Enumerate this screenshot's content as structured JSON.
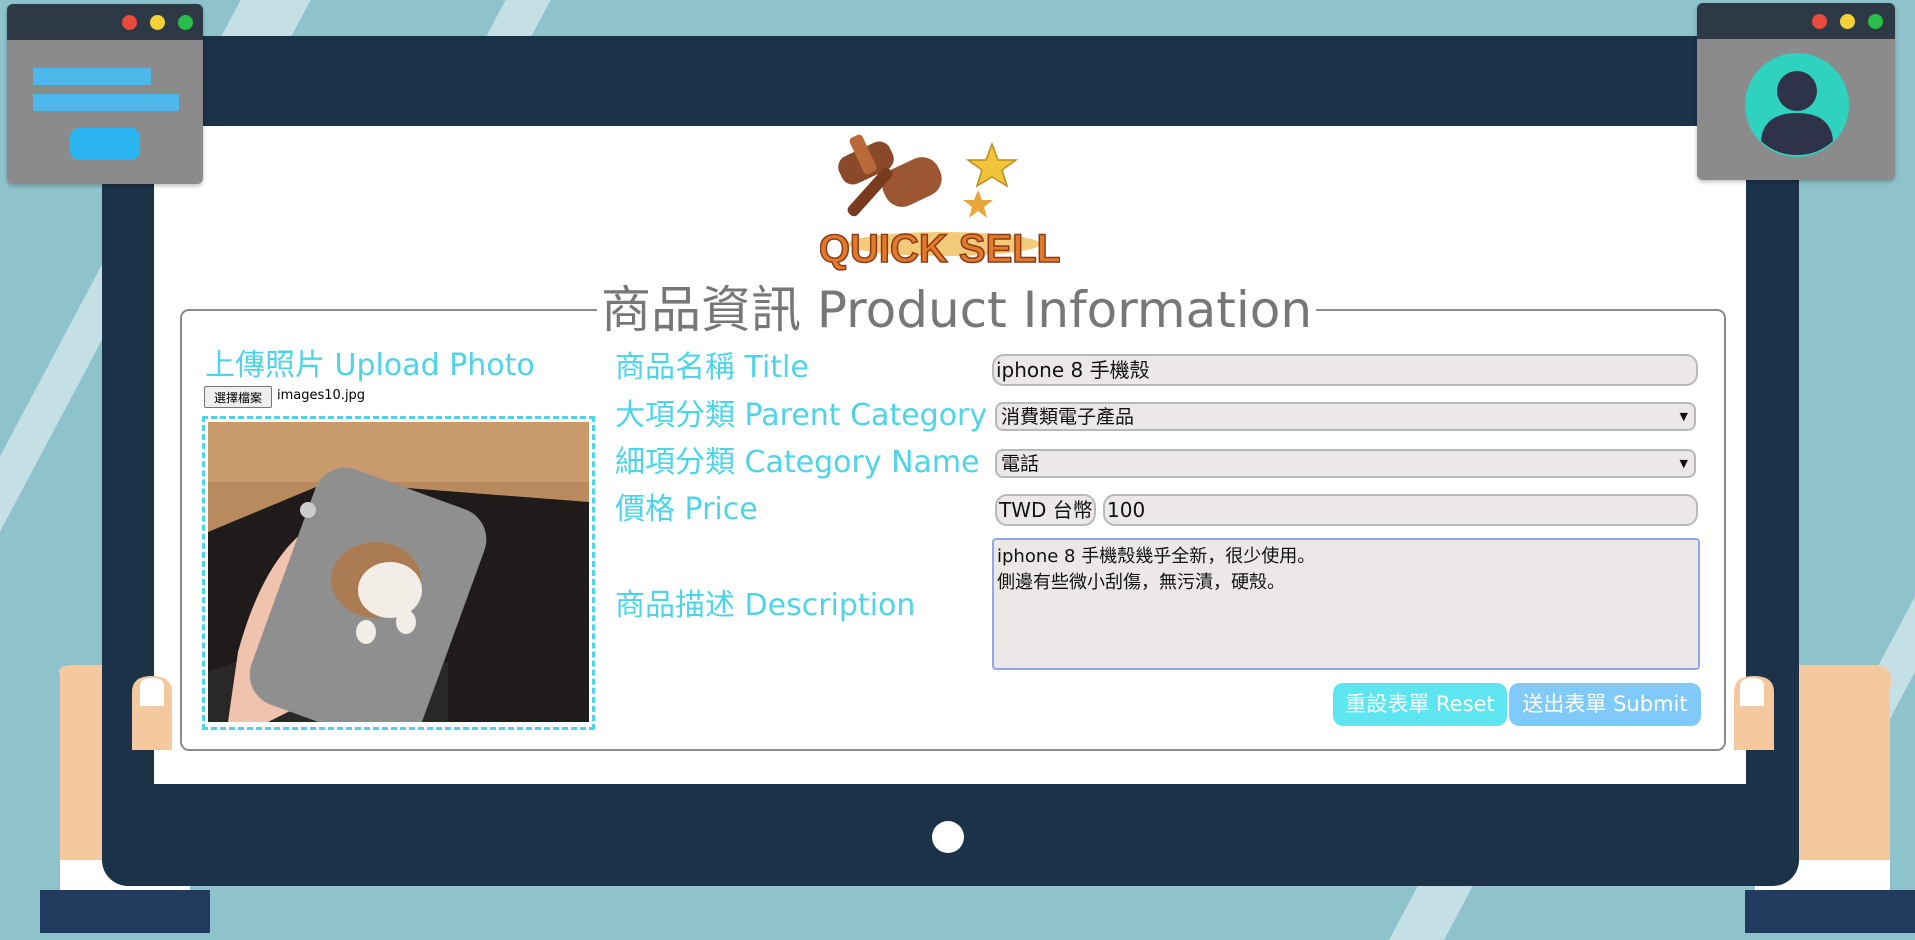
{
  "logo": {
    "text": "QUICK SELL"
  },
  "panel": {
    "legend": "商品資訊 Product Information"
  },
  "upload": {
    "label": "上傳照片 Upload Photo",
    "choose_file_button": "選擇檔案",
    "file_name": "images10.jpg"
  },
  "form": {
    "title_label": "商品名稱 Title",
    "title_value": "iphone 8 手機殼",
    "parent_category_label": "大項分類 Parent Category",
    "parent_category_value": "消費類電子產品",
    "category_name_label": "細項分類 Category Name",
    "category_name_value": "電話",
    "price_label": "價格 Price",
    "currency": "TWD 台幣",
    "price_value": "100",
    "description_label": "商品描述 Description",
    "description_value": "iphone 8 手機殼幾乎全新，很少使用。\n側邊有些微小刮傷，無污漬，硬殼。"
  },
  "buttons": {
    "reset": "重設表單 Reset",
    "submit": "送出表單 Submit"
  },
  "colors": {
    "background": "#8fc3cc",
    "tablet": "#1b3249",
    "label": "#4ed4e8",
    "reset_button": "#5ee6f0",
    "submit_button": "#7fcaf8"
  },
  "icons": [
    "browser-window-icon",
    "user-avatar-icon",
    "gavel-icon",
    "star-icon",
    "dropdown-arrow-icon"
  ]
}
